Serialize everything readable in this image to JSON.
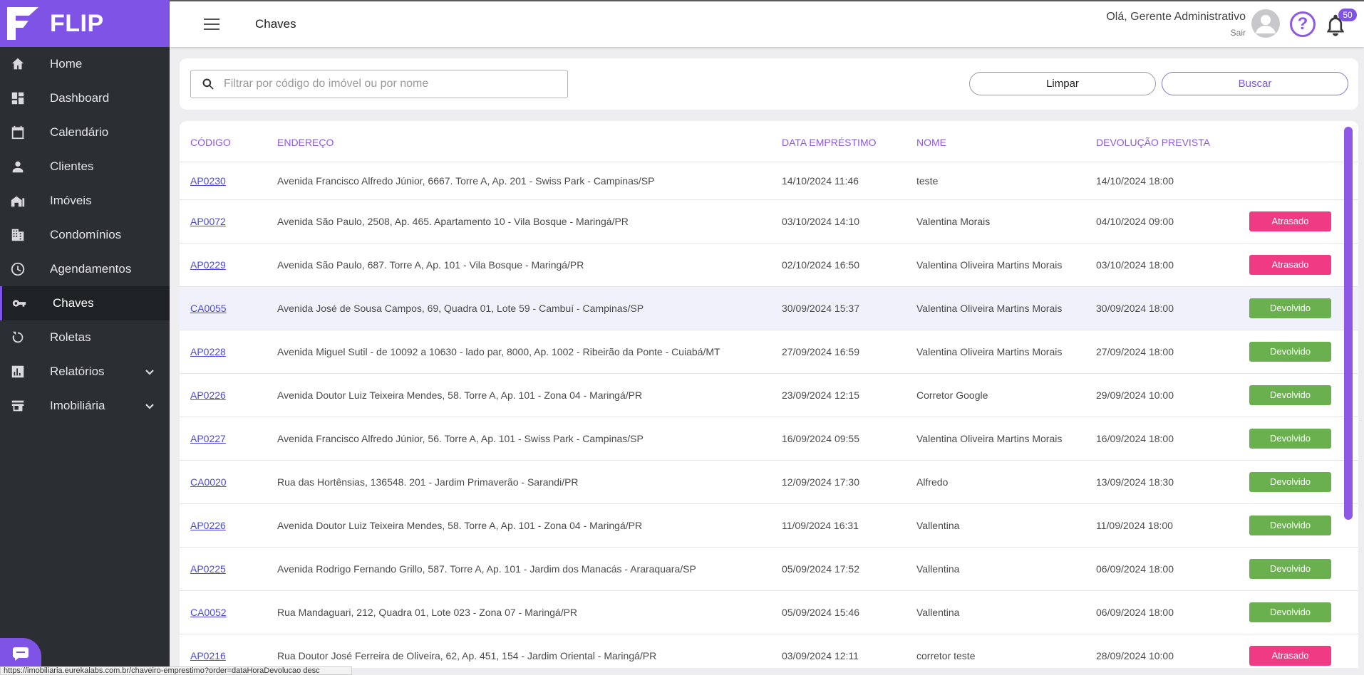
{
  "brand": {
    "name": "FLIP"
  },
  "sidebar": {
    "items": [
      {
        "label": "Home",
        "icon": "home-icon"
      },
      {
        "label": "Dashboard",
        "icon": "dashboard-icon"
      },
      {
        "label": "Calendário",
        "icon": "calendar-icon"
      },
      {
        "label": "Clientes",
        "icon": "person-icon"
      },
      {
        "label": "Imóveis",
        "icon": "house-icon"
      },
      {
        "label": "Condomínios",
        "icon": "building-icon"
      },
      {
        "label": "Agendamentos",
        "icon": "clock-icon"
      },
      {
        "label": "Chaves",
        "icon": "key-icon",
        "active": true
      },
      {
        "label": "Roletas",
        "icon": "roulette-icon"
      },
      {
        "label": "Relatórios",
        "icon": "bar-chart-icon",
        "expandable": true
      },
      {
        "label": "Imobiliária",
        "icon": "store-icon",
        "expandable": true
      }
    ]
  },
  "header": {
    "title": "Chaves",
    "greeting": "Olá, Gerente Administrativo",
    "logout": "Sair",
    "notifications_count": "50"
  },
  "filter": {
    "placeholder": "Filtrar por código do imóvel ou por nome",
    "value": "",
    "clear_label": "Limpar",
    "search_label": "Buscar"
  },
  "table": {
    "columns": [
      "Código",
      "Endereço",
      "Data Empréstimo",
      "Nome",
      "Devolução Prevista"
    ],
    "rows": [
      {
        "code": "AP0230",
        "address": "Avenida Francisco Alfredo Júnior, 6667. Torre A, Ap. 201 - Swiss Park - Campinas/SP",
        "loan_date": "14/10/2024 11:46",
        "name": "teste",
        "return_date": "14/10/2024 18:00",
        "status": ""
      },
      {
        "code": "AP0072",
        "address": "Avenida São Paulo, 2508, Ap. 465. Apartamento 10 - Vila Bosque - Maringá/PR",
        "loan_date": "03/10/2024 14:10",
        "name": "Valentina Morais",
        "return_date": "04/10/2024 09:00",
        "status": "Atrasado"
      },
      {
        "code": "AP0229",
        "address": "Avenida São Paulo, 687. Torre A, Ap. 101 - Vila Bosque - Maringá/PR",
        "loan_date": "02/10/2024 16:50",
        "name": "Valentina Oliveira Martins Morais",
        "return_date": "03/10/2024 18:00",
        "status": "Atrasado"
      },
      {
        "code": "CA0055",
        "address": "Avenida José de Sousa Campos, 69, Quadra 01, Lote 59 - Cambuí - Campinas/SP",
        "loan_date": "30/09/2024 15:37",
        "name": "Valentina Oliveira Martins Morais",
        "return_date": "30/09/2024 18:00",
        "status": "Devolvido"
      },
      {
        "code": "AP0228",
        "address": "Avenida Miguel Sutil - de 10092 a 10630 - lado par, 8000, Ap. 1002 - Ribeirão da Ponte - Cuiabá/MT",
        "loan_date": "27/09/2024 16:59",
        "name": "Valentina Oliveira Martins Morais",
        "return_date": "27/09/2024 18:00",
        "status": "Devolvido"
      },
      {
        "code": "AP0226",
        "address": "Avenida Doutor Luiz Teixeira Mendes, 58. Torre A, Ap. 101 - Zona 04 - Maringá/PR",
        "loan_date": "23/09/2024 12:15",
        "name": "Corretor Google",
        "return_date": "29/09/2024 10:00",
        "status": "Devolvido"
      },
      {
        "code": "AP0227",
        "address": "Avenida Francisco Alfredo Júnior, 56. Torre A, Ap. 101 - Swiss Park - Campinas/SP",
        "loan_date": "16/09/2024 09:55",
        "name": "Valentina Oliveira Martins Morais",
        "return_date": "16/09/2024 18:00",
        "status": "Devolvido"
      },
      {
        "code": "CA0020",
        "address": "Rua das Hortênsias, 136548. 201 - Jardim Primaverão - Sarandi/PR",
        "loan_date": "12/09/2024 17:30",
        "name": "Alfredo",
        "return_date": "13/09/2024 18:30",
        "status": "Devolvido"
      },
      {
        "code": "AP0226",
        "address": "Avenida Doutor Luiz Teixeira Mendes, 58. Torre A, Ap. 101 - Zona 04 - Maringá/PR",
        "loan_date": "11/09/2024 16:31",
        "name": "Vallentina",
        "return_date": "11/09/2024 18:00",
        "status": "Devolvido"
      },
      {
        "code": "AP0225",
        "address": "Avenida Rodrigo Fernando Grillo, 587. Torre A, Ap. 101 - Jardim dos Manacás - Araraquara/SP",
        "loan_date": "05/09/2024 17:52",
        "name": "Vallentina",
        "return_date": "06/09/2024 18:00",
        "status": "Devolvido"
      },
      {
        "code": "CA0052",
        "address": "Rua Mandaguari, 212, Quadra 01, Lote 023 - Zona 07 - Maringá/PR",
        "loan_date": "05/09/2024 15:46",
        "name": "Vallentina",
        "return_date": "06/09/2024 18:00",
        "status": "Devolvido"
      },
      {
        "code": "AP0216",
        "address": "Rua Doutor José Ferreira de Oliveira, 62, Ap. 451, 154 - Jardim Oriental - Maringá/PR",
        "loan_date": "03/09/2024 12:11",
        "name": "corretor teste",
        "return_date": "28/09/2024 10:00",
        "status": "Atrasado"
      }
    ]
  },
  "status_colors": {
    "Atrasado": "#f03a84",
    "Devolvido": "#6ab04f"
  },
  "accent_color": "#7f53e6",
  "statusbar": {
    "url": "https://imobiliaria.eurekalabs.com.br/chaveiro-emprestimo?order=dataHoraDevolucao desc"
  }
}
